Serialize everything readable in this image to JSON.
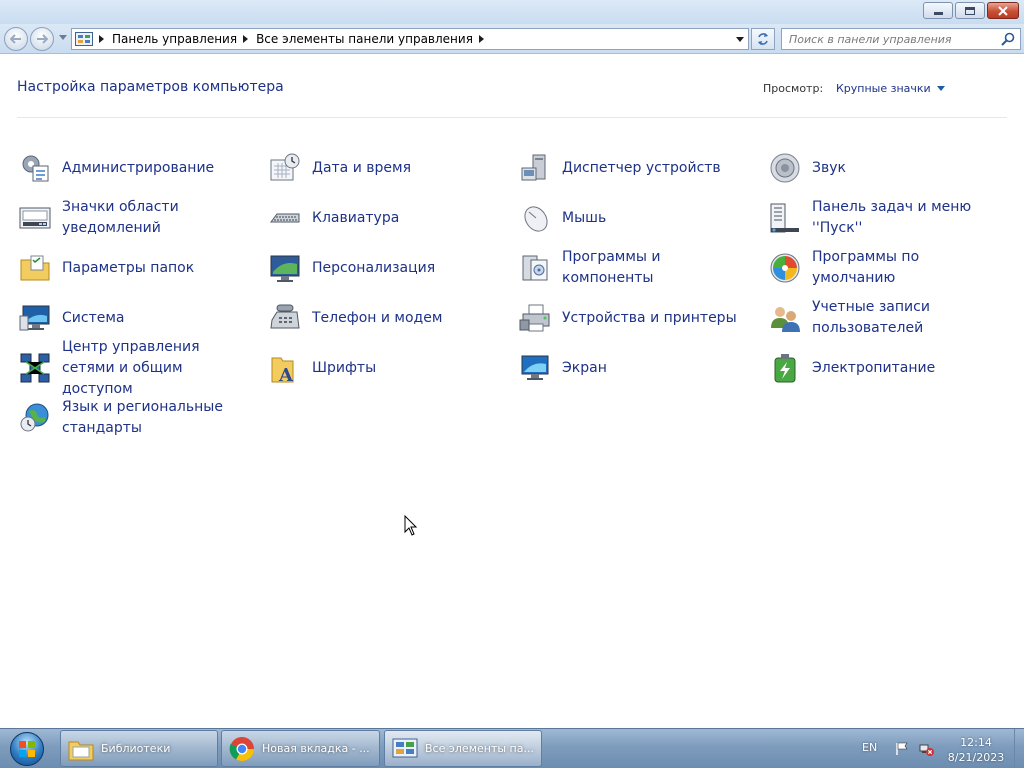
{
  "window": {
    "address": {
      "crumbs": [
        "Панель управления",
        "Все элементы панели управления"
      ]
    },
    "search": {
      "placeholder": "Поиск в панели управления"
    }
  },
  "content": {
    "title": "Настройка параметров компьютера",
    "view_label": "Просмотр:",
    "view_value": "Крупные значки"
  },
  "items": [
    {
      "label": "Администрирование",
      "icon": "admin-tools-icon"
    },
    {
      "label": "Дата и время",
      "icon": "calendar-clock-icon"
    },
    {
      "label": "Диспетчер устройств",
      "icon": "device-manager-icon"
    },
    {
      "label": "Звук",
      "icon": "speaker-icon"
    },
    {
      "label": "Значки области уведомлений",
      "icon": "notification-area-icon"
    },
    {
      "label": "Клавиатура",
      "icon": "keyboard-icon"
    },
    {
      "label": "Мышь",
      "icon": "mouse-icon"
    },
    {
      "label": "Панель задач и меню ''Пуск''",
      "icon": "taskbar-start-icon"
    },
    {
      "label": "Параметры папок",
      "icon": "folder-options-icon"
    },
    {
      "label": "Персонализация",
      "icon": "personalization-icon"
    },
    {
      "label": "Программы и компоненты",
      "icon": "programs-features-icon"
    },
    {
      "label": "Программы по умолчанию",
      "icon": "default-programs-icon"
    },
    {
      "label": "Система",
      "icon": "system-icon"
    },
    {
      "label": "Телефон и модем",
      "icon": "phone-modem-icon"
    },
    {
      "label": "Устройства и принтеры",
      "icon": "printer-icon"
    },
    {
      "label": "Учетные записи пользователей",
      "icon": "user-accounts-icon"
    },
    {
      "label": "Центр управления сетями и общим доступом",
      "icon": "network-center-icon"
    },
    {
      "label": "Шрифты",
      "icon": "fonts-icon"
    },
    {
      "label": "Экран",
      "icon": "display-icon"
    },
    {
      "label": "Электропитание",
      "icon": "power-options-icon"
    },
    {
      "label": "Язык и региональные стандарты",
      "icon": "region-language-icon"
    }
  ],
  "taskbar": {
    "tasks": [
      {
        "label": "Библиотеки",
        "icon": "libraries-icon"
      },
      {
        "label": "Новая вкладка - ...",
        "icon": "chrome-icon"
      },
      {
        "label": "Все элементы па...",
        "icon": "control-panel-icon"
      }
    ],
    "lang": "EN",
    "time": "12:14",
    "date": "8/21/2023"
  },
  "colors": {
    "link": "#1e3287",
    "taskbar": "#7e9cbd"
  }
}
